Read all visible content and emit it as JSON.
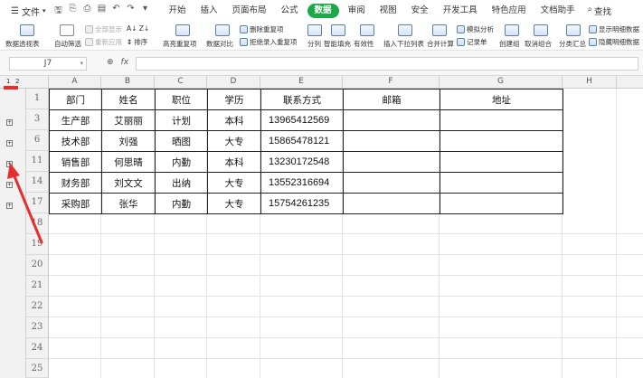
{
  "menu": {
    "file_label": "文件",
    "tabs": [
      "开始",
      "插入",
      "页面布局",
      "公式",
      "数据",
      "审阅",
      "视图",
      "安全",
      "开发工具",
      "特色应用",
      "文档助手"
    ],
    "active_tab": "数据",
    "search_label": "查找"
  },
  "ribbon": {
    "pivot": "数据透视表",
    "auto_filter": "自动筛选",
    "show_all": "全部显示",
    "reapply": "重新应用",
    "sort": "排序",
    "highlight_dup": "高亮重复项",
    "data_compare": "数据对比",
    "delete_dup": "删除重复项",
    "reject_dup": "拒绝录入重复项",
    "split": "分列",
    "smart_fill": "智能填充",
    "validity": "有效性",
    "dropdown": "插入下拉列表",
    "consolidate": "合并计算",
    "simulation": "模拟分析",
    "record": "记录单",
    "create_group": "创建组",
    "ungroup": "取消组合",
    "subtotal": "分类汇总",
    "show_detail": "显示明细数据",
    "hide_detail": "隐藏明细数据"
  },
  "formula_bar": {
    "cell_ref": "J7",
    "fx": "fx",
    "zoom_icon": "zoom-icon",
    "value": ""
  },
  "outline": {
    "levels": [
      "1",
      "2"
    ]
  },
  "columns": [
    "A",
    "B",
    "C",
    "D",
    "E",
    "F",
    "G",
    "H"
  ],
  "rows": [
    "1",
    "3",
    "6",
    "11",
    "14",
    "17",
    "18",
    "19",
    "20",
    "21",
    "22",
    "23",
    "24",
    "25"
  ],
  "table": {
    "header": [
      "部门",
      "姓名",
      "职位",
      "学历",
      "联系方式",
      "邮箱",
      "地址"
    ],
    "rows": [
      [
        "生产部",
        "艾丽丽",
        "计划",
        "本科",
        "13965412569",
        "",
        ""
      ],
      [
        "技术部",
        "刘强",
        "晒图",
        "大专",
        "15865478121",
        "",
        ""
      ],
      [
        "销售部",
        "何思晴",
        "内勤",
        "本科",
        "13230172548",
        "",
        ""
      ],
      [
        "财务部",
        "刘文文",
        "出纳",
        "大专",
        "13552316694",
        "",
        ""
      ],
      [
        "采购部",
        "张华",
        "内勤",
        "大专",
        "15754261235",
        "",
        ""
      ]
    ]
  },
  "colors": {
    "active_tab": "#1fa84a",
    "annotation": "#e62e2e"
  }
}
